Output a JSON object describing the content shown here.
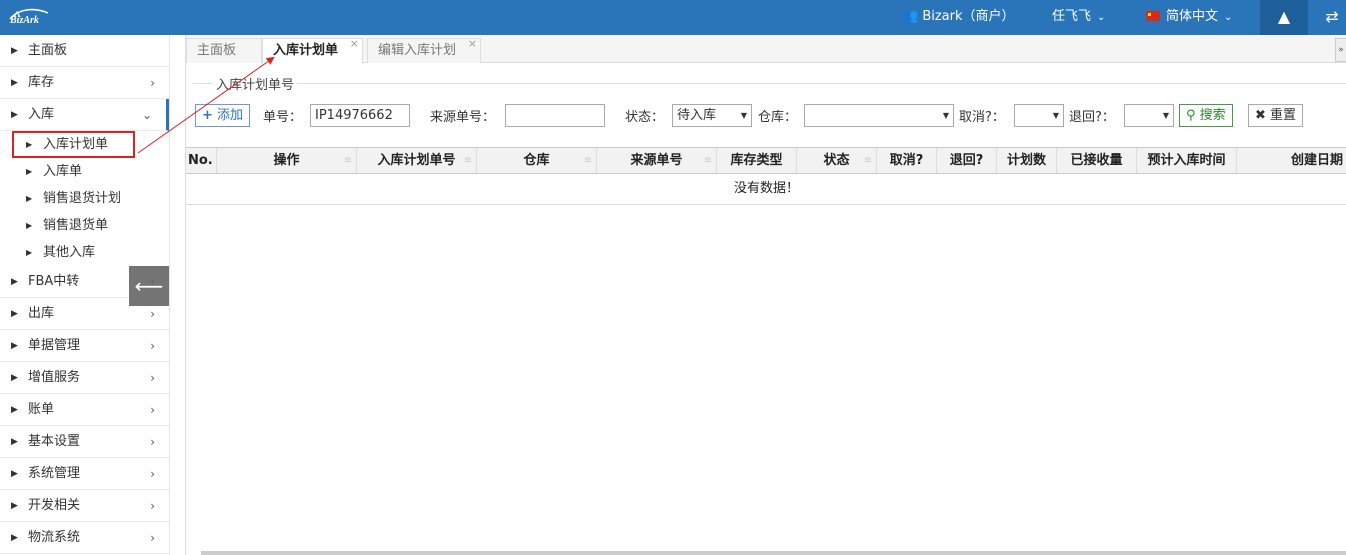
{
  "header": {
    "logo_text": "BizArk",
    "account": "Bizark（商户）",
    "user": "任飞飞",
    "language": "简体中文",
    "tree_icon": "tree-icon",
    "swap_icon": "swap-icon"
  },
  "sidebar": {
    "items": [
      {
        "label": "主面板"
      },
      {
        "label": "库存"
      },
      {
        "label": "入库"
      },
      {
        "label": "FBA中转"
      },
      {
        "label": "出库"
      },
      {
        "label": "单据管理"
      },
      {
        "label": "增值服务"
      },
      {
        "label": "账单"
      },
      {
        "label": "基本设置"
      },
      {
        "label": "系统管理"
      },
      {
        "label": "开发相关"
      },
      {
        "label": "物流系统"
      }
    ],
    "sub_items": [
      {
        "label": "入库计划单"
      },
      {
        "label": "入库单"
      },
      {
        "label": "销售退货计划"
      },
      {
        "label": "销售退货单"
      },
      {
        "label": "其他入库"
      }
    ]
  },
  "tabs": [
    {
      "label": "主面板"
    },
    {
      "label": "入库计划单"
    },
    {
      "label": "编辑入库计划"
    }
  ],
  "filter": {
    "legend": "入库计划单号",
    "add_label": "添加",
    "order_no_label": "单号：",
    "order_no_value": "IP14976662",
    "source_no_label": "来源单号：",
    "source_no_value": "",
    "status_label": "状态：",
    "status_value": "待入库",
    "warehouse_label": "仓库：",
    "warehouse_value": "",
    "cancel_label": "取消?：",
    "cancel_value": "",
    "return_label": "退回?：",
    "return_value": "",
    "search_label": "搜索",
    "reset_label": "重置"
  },
  "grid": {
    "columns": [
      "No.",
      "操作",
      "入库计划单号",
      "仓库",
      "来源单号",
      "库存类型",
      "状态",
      "取消?",
      "退回?",
      "计划数",
      "已接收量",
      "预计入库时间",
      "创建日期"
    ],
    "empty_text": "没有数据！"
  },
  "colors": {
    "header_bg": "#2a75b9",
    "highlight": "#dd2222"
  }
}
